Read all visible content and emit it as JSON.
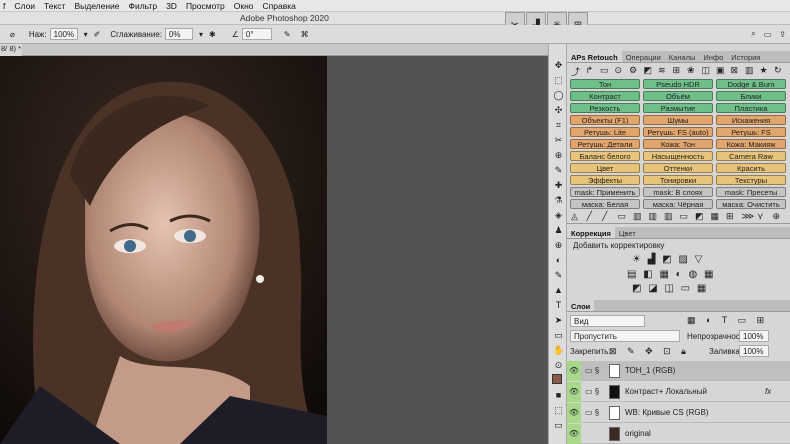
{
  "menubar": [
    "f",
    "Слои",
    "Текст",
    "Выделение",
    "Фильтр",
    "3D",
    "Просмотр",
    "Окно",
    "Справка"
  ],
  "window_title": "Adobe Photoshop 2020",
  "options": {
    "mode_label": "Наж:",
    "mode_value": "100%",
    "smooth_label": "Сглаживание:",
    "smooth_value": "0%",
    "angle_value": "0°"
  },
  "doc_tab": "8/ 8) *",
  "retouch_tabs": [
    "APs Retouch",
    "Операции",
    "Каналы",
    "Инфо",
    "История"
  ],
  "retouch_buttons": [
    [
      "Тон",
      "Pseudo HDR",
      "Dodge & Burn"
    ],
    [
      "Контраст",
      "Объём",
      "Блики"
    ],
    [
      "Резкость",
      "Размытие",
      "Пластика"
    ],
    [
      "Объекты (F1)",
      "Шумы",
      "Искажения"
    ],
    [
      "Ретушь: Lite",
      "Ретушь: FS (auto)",
      "Ретушь: FS"
    ],
    [
      "Ретушь: Детали",
      "Кожа: Тон",
      "Кожа: Макияж"
    ],
    [
      "Баланс белого",
      "Насыщенность",
      "Camera Raw"
    ],
    [
      "Цвет",
      "Оттенки",
      "Красить"
    ],
    [
      "Эффекты",
      "Тонировки",
      "Текстуры"
    ],
    [
      "mask: Применить",
      "mask: В слоях",
      "mask: Пресеты"
    ],
    [
      "маска: Белая",
      "маска: Чёрная",
      "маска: Очистить"
    ]
  ],
  "colors": {
    "green": "#6fbf8b",
    "orange": "#e2a56b",
    "yellow": "#e8c47a",
    "grey": "#c4c4c4"
  },
  "adjust": {
    "tabs": [
      "Коррекция",
      "Цвет"
    ],
    "add_label": "Добавить корректировку"
  },
  "layers": {
    "tab": "Слои",
    "filter": "Вид",
    "blend": "Пропустить",
    "opacity_label": "Непрозрачность:",
    "opacity_value": "100%",
    "lock_label": "Закрепить:",
    "fill_label": "Заливка:",
    "fill_value": "100%",
    "items": [
      {
        "name": "ТОН_1 (RGB)"
      },
      {
        "name": "Контраст+ Локальный",
        "fx": "fx"
      },
      {
        "name": "WB: Кривые CS (RGB)"
      },
      {
        "name": "original"
      }
    ]
  }
}
